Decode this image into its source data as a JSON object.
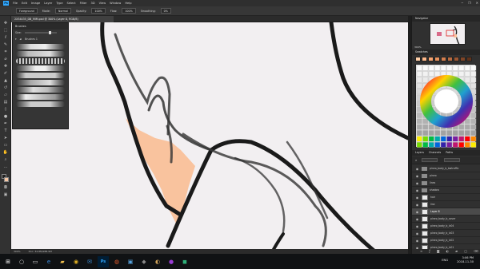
{
  "app": {
    "logo": "Ps",
    "menu": [
      "File",
      "Edit",
      "Image",
      "Layer",
      "Type",
      "Select",
      "Filter",
      "3D",
      "View",
      "Window",
      "Help"
    ],
    "window_controls": [
      "─",
      "❐",
      "✕"
    ]
  },
  "options_bar": {
    "preset": "Foreground",
    "mode_label": "Mode:",
    "mode_value": "Normal",
    "opacity_label": "Opacity:",
    "opacity_value": "100%",
    "flow_label": "Flow:",
    "flow_value": "100%",
    "smoothing_label": "Smoothing:",
    "smoothing_value": "0%"
  },
  "document": {
    "tab_title": "2X34435_DB_MIM.psd @ 300% (Layer 8, RGB/8)",
    "zoom": "300%",
    "doc_info": "Doc: 34.8M/288.9M"
  },
  "brushes_panel": {
    "title": "Brushes",
    "size_label": "Size:",
    "group_label": "Brushes 1"
  },
  "navigator": {
    "tabs": [
      "Navigator"
    ],
    "zoom": "300%"
  },
  "swatches": {
    "tabs": [
      "Swatches"
    ],
    "colors": [
      "#ffcfa8",
      "#ffb98a",
      "#f7a36f",
      "#e8925e",
      "#d47f4e",
      "#b96b40",
      "#9c5733",
      "#7f4527",
      "#5f321b"
    ]
  },
  "color_wheel_colors": [
    "#ff0000",
    "#ff8800",
    "#ffee00",
    "#77dd00",
    "#00bb44",
    "#00aaaa",
    "#0066dd",
    "#3322aa",
    "#7a1ea0",
    "#c0166f"
  ],
  "layers": {
    "tabs": [
      "Layers",
      "Channels",
      "Paths"
    ],
    "items": [
      {
        "name": "pineo_body_b_bwtraffic",
        "type": "folder",
        "sel": false
      },
      {
        "name": "pineo",
        "type": "folder",
        "sel": false
      },
      {
        "name": "lines",
        "type": "folder",
        "sel": false
      },
      {
        "name": "shadow",
        "type": "folder",
        "sel": false
      },
      {
        "name": "hair",
        "type": "layer",
        "sel": false
      },
      {
        "name": "line",
        "type": "layer",
        "sel": false
      },
      {
        "name": "Layer 8",
        "type": "layer",
        "sel": true
      },
      {
        "name": "pineo_body_b_cover",
        "type": "layer",
        "sel": false
      },
      {
        "name": "pineo_body_b_lc04",
        "type": "layer",
        "sel": false
      },
      {
        "name": "pineo_body_b_lc03",
        "type": "layer",
        "sel": false
      },
      {
        "name": "pineo_body_b_lc02",
        "type": "layer",
        "sel": false
      },
      {
        "name": "pineo_body_b_lc01",
        "type": "layer",
        "sel": false
      }
    ]
  },
  "taskbar": {
    "icons": [
      {
        "name": "start-icon",
        "glyph": "⊞",
        "color": "#ffffff"
      },
      {
        "name": "search-icon",
        "glyph": "○",
        "color": "#dddddd"
      },
      {
        "name": "task-view-icon",
        "glyph": "▭",
        "color": "#dddddd"
      },
      {
        "name": "edge-icon",
        "glyph": "e",
        "color": "#3c8de0"
      },
      {
        "name": "folder-icon",
        "glyph": "▰",
        "color": "#f2c14e"
      },
      {
        "name": "chrome-icon",
        "glyph": "◉",
        "color": "#e3b223"
      },
      {
        "name": "mail-icon",
        "glyph": "✉",
        "color": "#3b8cd6"
      },
      {
        "name": "photoshop-icon",
        "glyph": "Ps",
        "color": "#31a8ff"
      },
      {
        "name": "app-icon-1",
        "glyph": "◍",
        "color": "#e05a2a"
      },
      {
        "name": "app-icon-2",
        "glyph": "▣",
        "color": "#57a4e0"
      },
      {
        "name": "app-icon-3",
        "glyph": "◆",
        "color": "#888888"
      },
      {
        "name": "app-icon-4",
        "glyph": "◐",
        "color": "#cfa25a"
      },
      {
        "name": "app-icon-5",
        "glyph": "●",
        "color": "#9a3dd6"
      },
      {
        "name": "app-icon-6",
        "glyph": "◼",
        "color": "#2fb07a"
      }
    ],
    "lang": "ENG",
    "time": "3:06 PM",
    "date": "2018-11-30"
  }
}
